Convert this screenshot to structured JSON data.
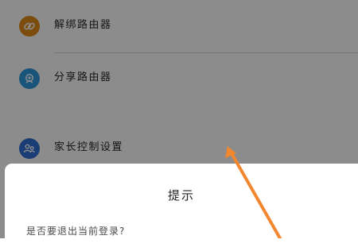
{
  "settings": {
    "items": [
      {
        "label": "解绑路由器",
        "icon": "link-icon",
        "color": "#e08a14"
      },
      {
        "label": "分享路由器",
        "icon": "share-router-icon",
        "color": "#2f9be0"
      },
      {
        "label": "家长控制设置",
        "icon": "parental-control-icon",
        "color": "#2f6fd4"
      }
    ]
  },
  "dialog": {
    "title": "提示",
    "message": "是否要退出当前登录?"
  },
  "colors": {
    "overlay": "rgba(0,0,0,0.45)",
    "annotation_arrow": "#f2872f"
  }
}
